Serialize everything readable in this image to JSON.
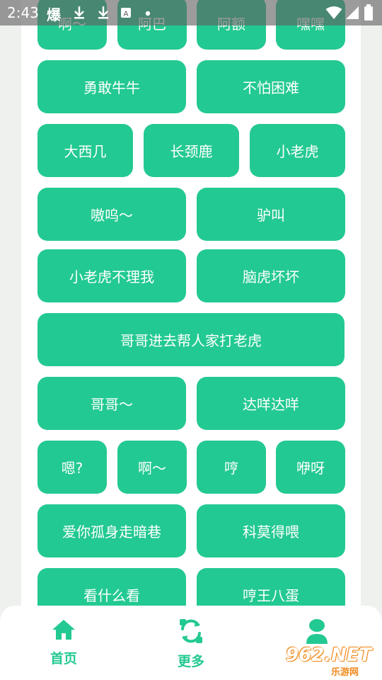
{
  "status_bar": {
    "time": "2:43",
    "notification_char": "爆"
  },
  "buttons": {
    "r0": [
      "啊～",
      "阿巴",
      "阿额",
      "嘿嘿"
    ],
    "r1": [
      "勇敢牛牛",
      "不怕困难"
    ],
    "r2": [
      "大西几",
      "长颈鹿",
      "小老虎"
    ],
    "r3": [
      "嗷呜～",
      "驴叫"
    ],
    "r4": [
      "小老虎不理我",
      "脑虎坏坏"
    ],
    "r5": [
      "哥哥进去帮人家打老虎"
    ],
    "r6": [
      "哥哥～",
      "达咩达咩"
    ],
    "r7": [
      "嗯?",
      "啊～",
      "哼",
      "咿呀"
    ],
    "r8": [
      "爱你孤身走暗巷",
      "科莫得喂"
    ],
    "r9": [
      "看什么看",
      "哼王八蛋"
    ]
  },
  "nav": {
    "home": "首页",
    "more": "更多",
    "profile": ""
  },
  "watermark": {
    "number": "962.NET",
    "site": "乐游网"
  },
  "colors": {
    "accent": "#23c992",
    "background": "#eef1ee"
  }
}
